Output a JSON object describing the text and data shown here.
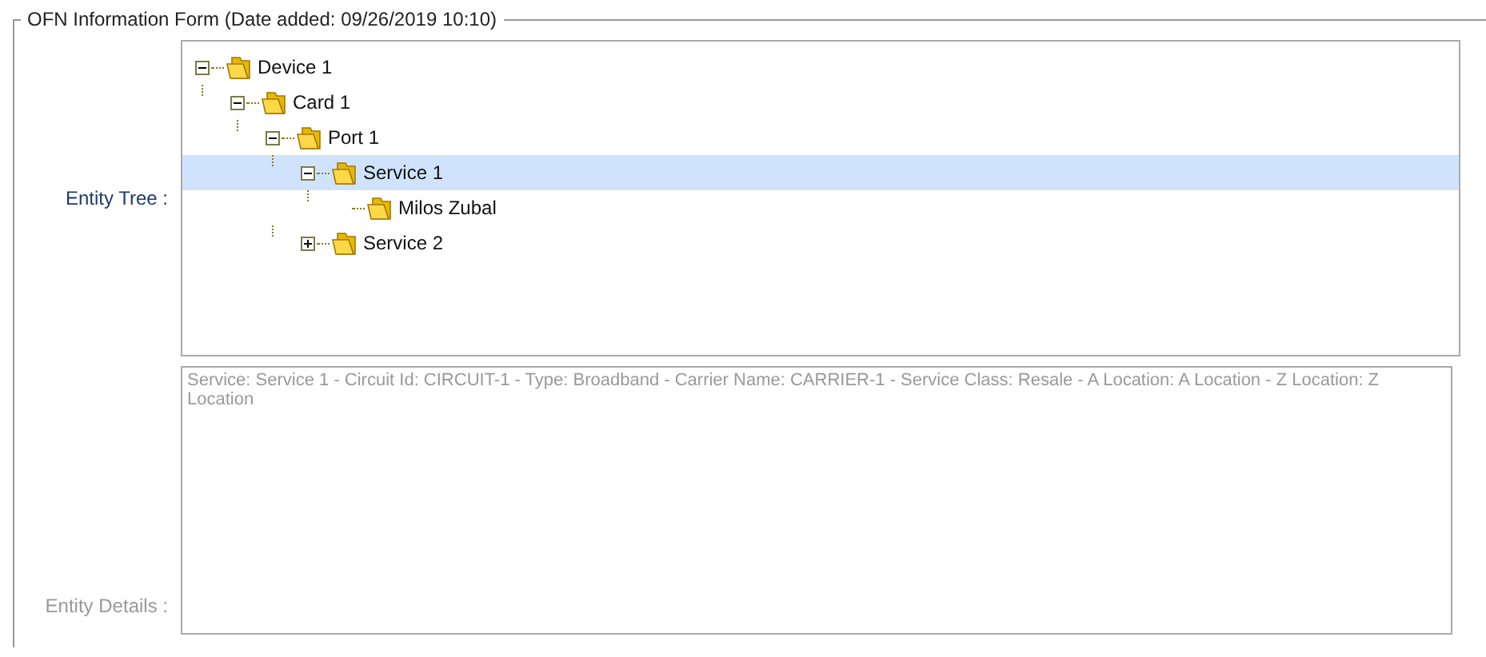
{
  "form": {
    "legend": "OFN Information Form (Date added: 09/26/2019 10:10)"
  },
  "entity_tree": {
    "label": "Entity Tree :",
    "nodes": [
      {
        "label": "Device 1",
        "expanded": true,
        "selected": false,
        "children": [
          {
            "label": "Card 1",
            "expanded": true,
            "selected": false,
            "children": [
              {
                "label": "Port 1",
                "expanded": true,
                "selected": false,
                "children": [
                  {
                    "label": "Service 1",
                    "expanded": true,
                    "selected": true,
                    "children": [
                      {
                        "label": "Milos Zubal",
                        "selected": false
                      }
                    ]
                  },
                  {
                    "label": "Service 2",
                    "expanded": false,
                    "selected": false
                  }
                ]
              }
            ]
          }
        ]
      }
    ]
  },
  "entity_details": {
    "label": "Entity Details :",
    "value": "Service: Service 1 - Circuit Id: CIRCUIT-1 - Type: Broadband - Carrier Name: CARRIER-1 - Service Class: Resale - A Location: A Location - Z Location: Z Location"
  }
}
